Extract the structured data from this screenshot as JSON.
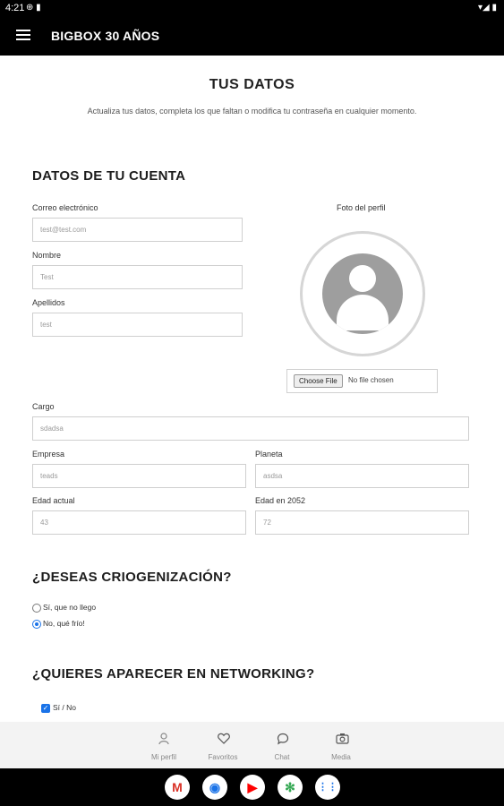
{
  "status_bar": {
    "time": "4:21",
    "left_icons": "⊕ ▮",
    "right_icons": "▾◢ ▮"
  },
  "app_bar": {
    "title": "BIGBOX 30 AÑOS"
  },
  "page": {
    "title": "TUS DATOS",
    "subtitle": "Actualiza tus datos, completa los que faltan o modifica tu contraseña en cualquier momento."
  },
  "account": {
    "heading": "DATOS DE TU CUENTA",
    "email": {
      "label": "Correo electrónico",
      "value": "test@test.com"
    },
    "nombre": {
      "label": "Nombre",
      "value": "Test"
    },
    "apellidos": {
      "label": "Apellidos",
      "value": "test"
    },
    "foto": {
      "label": "Foto del perfil",
      "button": "Choose File",
      "status": "No file chosen"
    },
    "cargo": {
      "label": "Cargo",
      "value": "sdadsa"
    },
    "empresa": {
      "label": "Empresa",
      "value": "teads"
    },
    "planeta": {
      "label": "Planeta",
      "value": "asdsa"
    },
    "edad_actual": {
      "label": "Edad actual",
      "value": "43"
    },
    "edad_2052": {
      "label": "Edad en 2052",
      "value": "72"
    }
  },
  "crio": {
    "heading": "¿DESEAS CRIOGENIZACIÓN?",
    "options": [
      "Sí, que no llego",
      "No, qué frío!"
    ],
    "selected": "No, qué frío!"
  },
  "networking": {
    "heading": "¿QUIERES APARECER EN NETWORKING?",
    "checkbox_label": "Sí / No",
    "checked": true
  },
  "bottom_nav": {
    "items": [
      {
        "label": "Mi perfil",
        "icon": "person-icon"
      },
      {
        "label": "Favoritos",
        "icon": "heart-icon"
      },
      {
        "label": "Chat",
        "icon": "chat-icon"
      },
      {
        "label": "Media",
        "icon": "camera-icon"
      }
    ]
  },
  "dock": {
    "apps": [
      {
        "name": "gmail-icon",
        "glyph": "M",
        "color": "#d93025"
      },
      {
        "name": "chrome-icon",
        "glyph": "◉",
        "color": "#1a73e8"
      },
      {
        "name": "youtube-icon",
        "glyph": "▶",
        "color": "#ff0000"
      },
      {
        "name": "photos-icon",
        "glyph": "✻",
        "color": "#34a853"
      },
      {
        "name": "apps-icon",
        "glyph": "⋮⋮",
        "color": "#1a73e8"
      }
    ]
  }
}
